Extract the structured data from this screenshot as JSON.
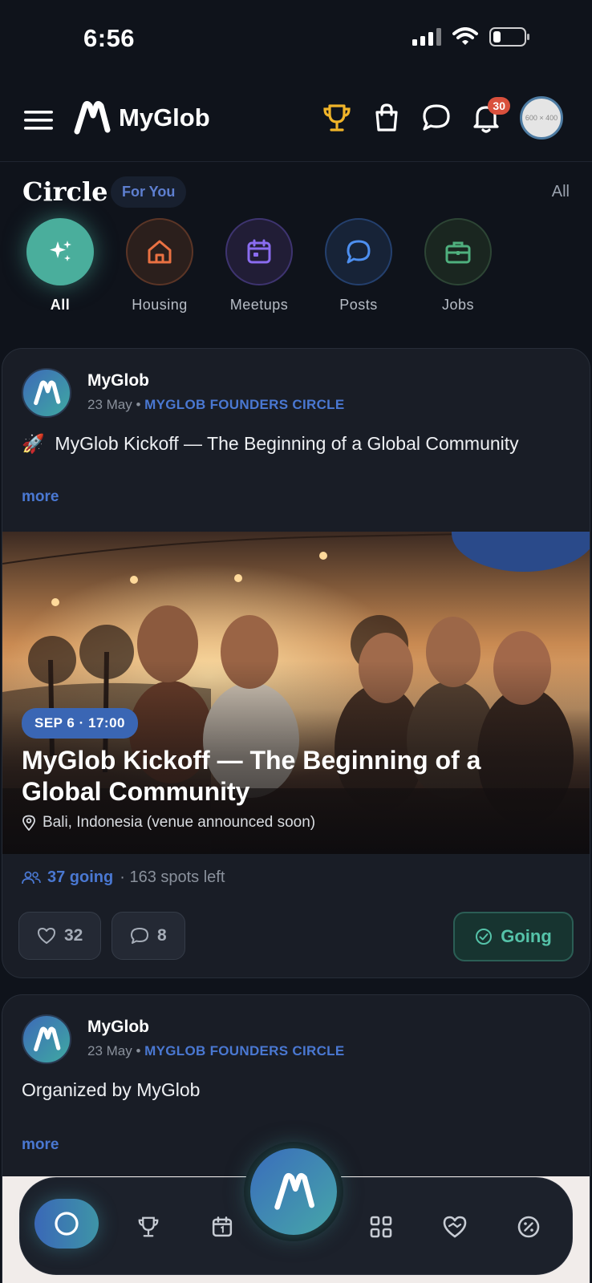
{
  "status_bar": {
    "time": "6:56"
  },
  "app_bar": {
    "brand": "MyGlob",
    "avatar_placeholder": "600 × 400",
    "notification_count": "30"
  },
  "circle": {
    "title": "Circle",
    "filter": "For You",
    "all_label": "All",
    "categories": [
      {
        "label": "All",
        "icon": "sparkles-icon",
        "active": true
      },
      {
        "label": "Housing",
        "icon": "home-icon"
      },
      {
        "label": "Meetups",
        "icon": "calendar-icon"
      },
      {
        "label": "Posts",
        "icon": "chat-bubble-icon"
      },
      {
        "label": "Jobs",
        "icon": "briefcase-icon"
      }
    ]
  },
  "posts": [
    {
      "author": "MyGlob",
      "date": "23 May",
      "separator": "•",
      "circle": "MYGLOB FOUNDERS CIRCLE",
      "emoji": "🚀",
      "text": "MyGlob Kickoff — The Beginning of a Global Community",
      "more": "more",
      "event": {
        "date_chip": "SEP 6 · 17:00",
        "title": "MyGlob Kickoff — The Beginning of a Global Community",
        "location": "Bali, Indonesia (venue announced soon)",
        "going": "37 going",
        "spots": "· 163 spots left"
      },
      "likes": "32",
      "comments": "8",
      "rsvp_label": "Going"
    },
    {
      "author": "MyGlob",
      "date": "23 May",
      "separator": "•",
      "circle": "MYGLOB FOUNDERS CIRCLE",
      "text": "Organized by MyGlob",
      "more": "more"
    }
  ],
  "bottom_nav": {
    "items": [
      "circle-icon",
      "trophy-icon",
      "calendar-icon",
      "grid-icon",
      "handshake-heart-icon",
      "percent-badge-icon"
    ]
  },
  "colors": {
    "accent_blue": "#4a78d2",
    "accent_teal": "#55c3a9",
    "trophy": "#f0b429",
    "badge_red": "#d9503d"
  }
}
